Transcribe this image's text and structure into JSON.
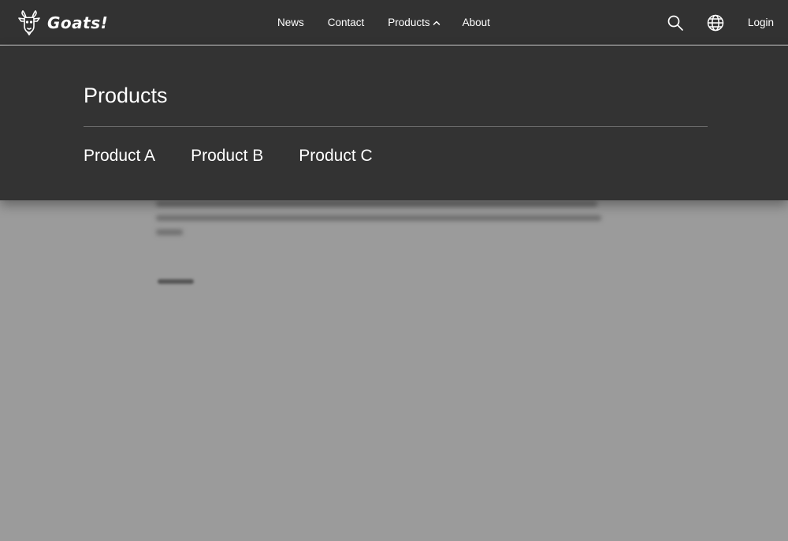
{
  "brand": {
    "name": "Goats!",
    "logo_icon": "goat-head-icon"
  },
  "nav": {
    "links": [
      "News",
      "Contact",
      "Products",
      "About"
    ],
    "products_expanded": true,
    "search_icon": "search-icon",
    "language_icon": "globe-icon",
    "login_label": "Login"
  },
  "mega_menu": {
    "title": "Products",
    "items": [
      "Product A",
      "Product B",
      "Product C"
    ]
  },
  "colors": {
    "navbar_bg": "#323232",
    "menu_bg": "#333333",
    "overlay_bg": "#9b9b9b",
    "text": "#ffffff"
  }
}
